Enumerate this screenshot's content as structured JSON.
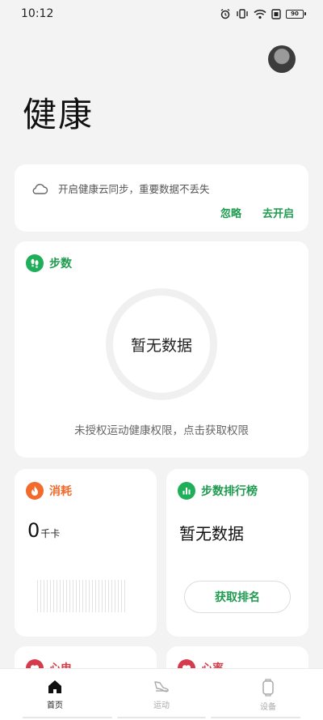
{
  "status_bar": {
    "time": "10:12",
    "battery": "90",
    "icons": [
      "alarm-icon",
      "vibrate-icon",
      "wifi-icon",
      "sim-icon",
      "battery-icon"
    ]
  },
  "header": {
    "title": "健康",
    "avatar_icon": "user-avatar"
  },
  "sync_card": {
    "icon": "cloud-icon",
    "message": "开启健康云同步，重要数据不丢失",
    "ignore_label": "忽略",
    "enable_label": "去开启"
  },
  "steps_card": {
    "icon": "footprint-icon",
    "title": "步数",
    "empty_text": "暂无数据",
    "hint": "未授权运动健康权限，点击获取权限"
  },
  "burn_card": {
    "icon": "flame-icon",
    "title": "消耗",
    "value": "0",
    "unit": "千卡"
  },
  "rank_card": {
    "icon": "bar-chart-icon",
    "title": "步数排行榜",
    "empty_text": "暂无数据",
    "button_label": "获取排名"
  },
  "peek_cards": {
    "left_title": "心电",
    "right_title": "心率"
  },
  "bottom_nav": {
    "items": [
      {
        "label": "首页",
        "icon": "home-icon",
        "active": true
      },
      {
        "label": "运动",
        "icon": "shoe-icon",
        "active": false
      },
      {
        "label": "设备",
        "icon": "watch-icon",
        "active": false
      }
    ]
  },
  "colors": {
    "accent_green": "#1f9b4f",
    "flame_orange": "#f26b2d",
    "heart_red": "#d53b4a",
    "background": "#f3f3f3"
  }
}
